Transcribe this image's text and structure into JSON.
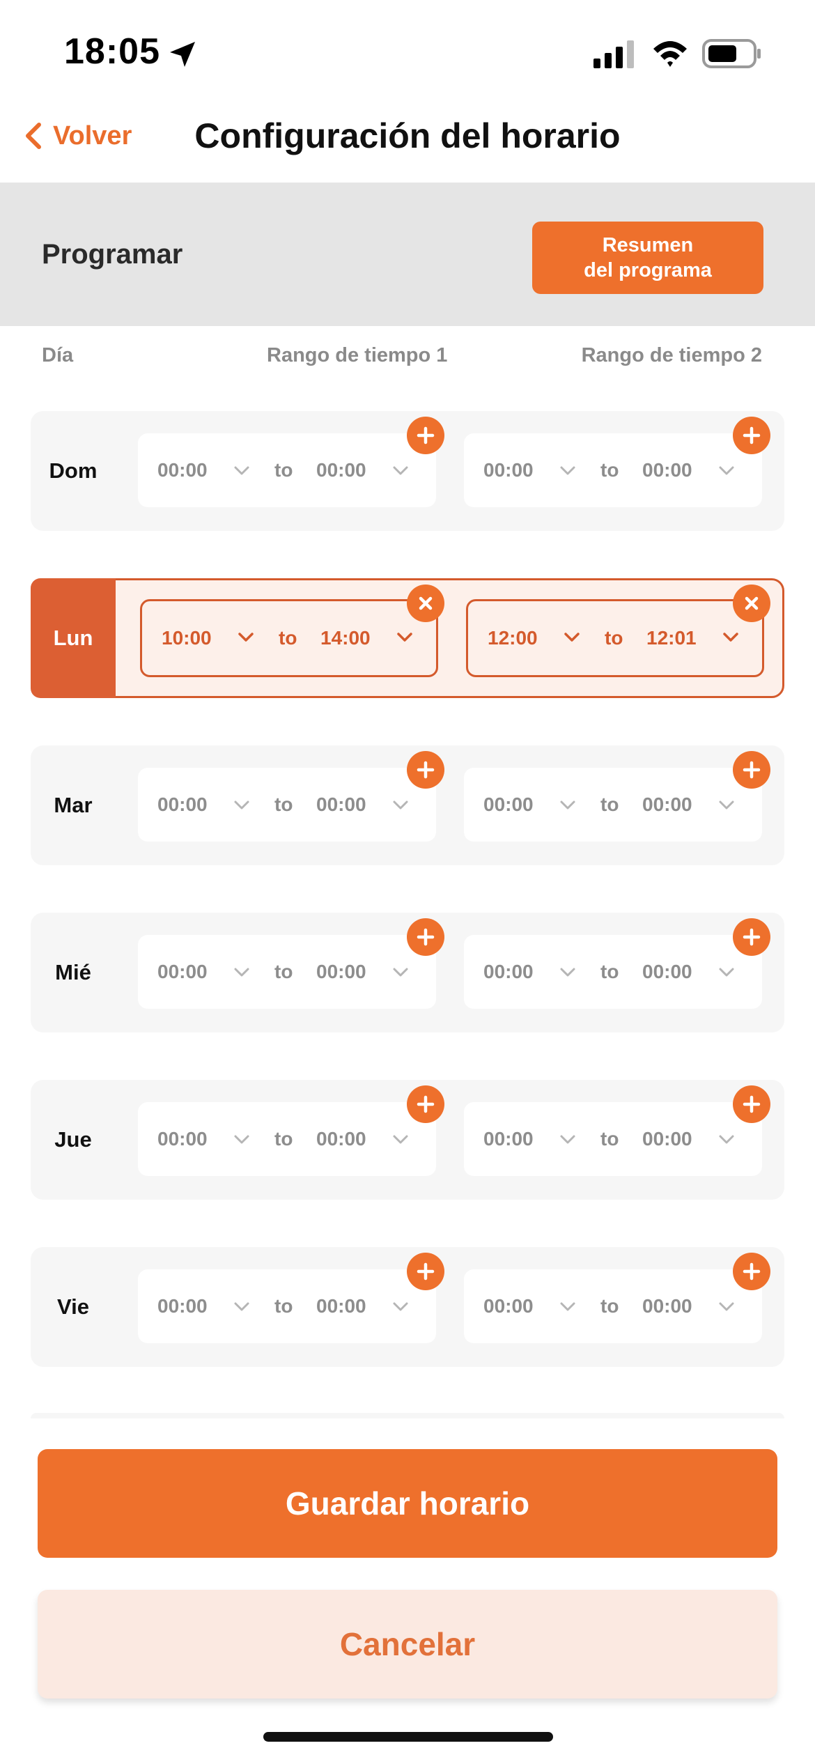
{
  "status": {
    "time": "18:05"
  },
  "nav": {
    "back_label": "Volver",
    "title": "Configuración del horario"
  },
  "program": {
    "label": "Programar",
    "summary_line1": "Resumen",
    "summary_line2": "del programa"
  },
  "columns": {
    "day": "Día",
    "range1": "Rango de tiempo 1",
    "range2": "Rango de tiempo 2"
  },
  "rows": [
    {
      "day": "Dom",
      "active": false,
      "r1_from": "00:00",
      "r1_sep": "to",
      "r1_to": "00:00",
      "r2_from": "00:00",
      "r2_sep": "to",
      "r2_to": "00:00"
    },
    {
      "day": "Lun",
      "active": true,
      "r1_from": "10:00",
      "r1_sep": "to",
      "r1_to": "14:00",
      "r2_from": "12:00",
      "r2_sep": "to",
      "r2_to": "12:01"
    },
    {
      "day": "Mar",
      "active": false,
      "r1_from": "00:00",
      "r1_sep": "to",
      "r1_to": "00:00",
      "r2_from": "00:00",
      "r2_sep": "to",
      "r2_to": "00:00"
    },
    {
      "day": "Mié",
      "active": false,
      "r1_from": "00:00",
      "r1_sep": "to",
      "r1_to": "00:00",
      "r2_from": "00:00",
      "r2_sep": "to",
      "r2_to": "00:00"
    },
    {
      "day": "Jue",
      "active": false,
      "r1_from": "00:00",
      "r1_sep": "to",
      "r1_to": "00:00",
      "r2_from": "00:00",
      "r2_sep": "to",
      "r2_to": "00:00"
    },
    {
      "day": "Vie",
      "active": false,
      "r1_from": "00:00",
      "r1_sep": "to",
      "r1_to": "00:00",
      "r2_from": "00:00",
      "r2_sep": "to",
      "r2_to": "00:00"
    }
  ],
  "actions": {
    "save": "Guardar horario",
    "cancel": "Cancelar"
  },
  "colors": {
    "accent": "#ee702c",
    "active": "#d45a2c",
    "row_bg": "#f6f6f6",
    "cancel_bg": "#fbe9e1"
  },
  "icons": {
    "add": "plus-circle-icon",
    "remove": "x-circle-icon",
    "dropdown": "chevron-down-icon",
    "back": "chevron-left-icon"
  }
}
